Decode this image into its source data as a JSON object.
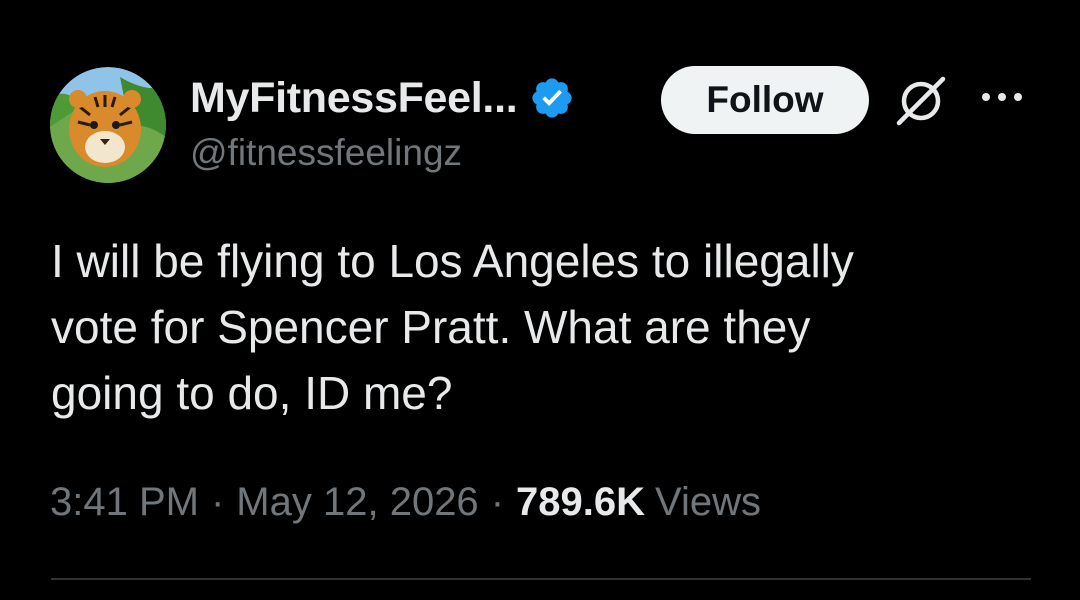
{
  "author": {
    "display_name": "MyFitnessFeel...",
    "handle": "@fitnessfeelingz",
    "avatar": "tiger-avatar",
    "verified_icon": "verified-badge-icon"
  },
  "actions": {
    "follow_label": "Follow",
    "grok_icon": "grok-icon",
    "more_icon": "more-options-icon"
  },
  "tweet": {
    "text": "I will be flying to Los Angeles to illegally\nvote for Spencer Pratt. What are they\ngoing to do, ID me?"
  },
  "meta": {
    "time": "3:41 PM",
    "separator": "·",
    "date": "May 12, 2026",
    "views_count": "789.6K",
    "views_label": "Views"
  },
  "colors": {
    "background": "#000000",
    "text_primary": "#e7e9ea",
    "text_secondary": "#71767b",
    "verified_blue": "#1d9bf0",
    "follow_bg": "#eff3f4",
    "divider": "#2f3336"
  }
}
